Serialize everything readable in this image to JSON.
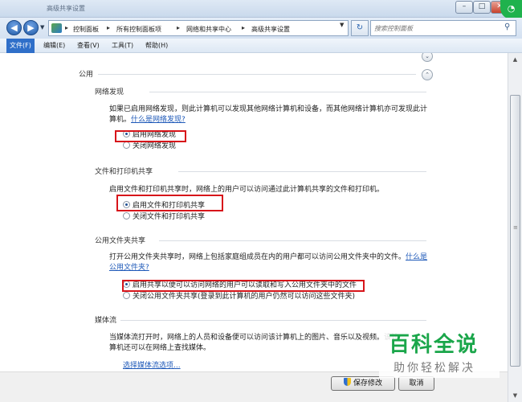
{
  "window": {
    "title": "高级共享设置"
  },
  "address": {
    "crumbs": [
      "控制面板",
      "所有控制面板项",
      "网络和共享中心",
      "高级共享设置"
    ],
    "separator": "▸"
  },
  "search": {
    "placeholder": "搜索控制面板"
  },
  "menu": {
    "items": [
      {
        "label": "文件(F)",
        "active": true
      },
      {
        "label": "编辑(E)"
      },
      {
        "label": "查看(V)"
      },
      {
        "label": "工具(T)"
      },
      {
        "label": "帮助(H)"
      }
    ]
  },
  "profile": {
    "name": "公用"
  },
  "sections": {
    "network_discovery": {
      "title": "网络发现",
      "desc": "如果已启用网络发现，则此计算机可以发现其他网络计算机和设备，而其他网络计算机亦可发现此计算机。",
      "link": "什么是网络发现?",
      "options": [
        "启用网络发现",
        "关闭网络发现"
      ]
    },
    "file_printer": {
      "title": "文件和打印机共享",
      "desc": "启用文件和打印机共享时，网络上的用户可以访问通过此计算机共享的文件和打印机。",
      "options": [
        "启用文件和打印机共享",
        "关闭文件和打印机共享"
      ]
    },
    "public_folder": {
      "title": "公用文件夹共享",
      "desc": "打开公用文件夹共享时，网络上包括家庭组成员在内的用户都可以访问公用文件夹中的文件。",
      "link": "什么是公用文件夹?",
      "options": [
        "启用共享以便可以访问网络的用户可以读取和写入公用文件夹中的文件",
        "关闭公用文件夹共享(登录到此计算机的用户仍然可以访问这些文件夹)"
      ]
    },
    "media": {
      "title": "媒体流",
      "desc": "当媒体流打开时，网络上的人员和设备便可以访问该计算机上的图片、音乐以及视频。该计算机还可以在网络上查找媒体。",
      "link": "选择媒体流选项..."
    }
  },
  "buttons": {
    "save": "保存修改",
    "cancel": "取消"
  },
  "watermark": {
    "title": "百科全说",
    "subtitle": "助你轻松解决"
  }
}
